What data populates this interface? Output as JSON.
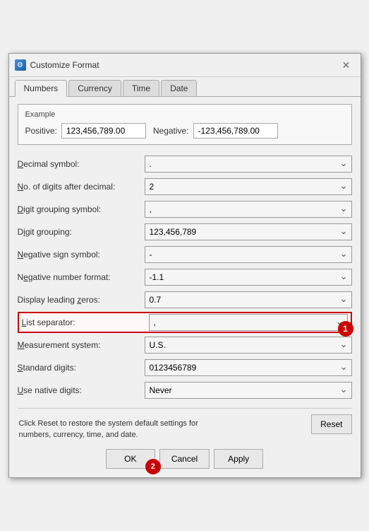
{
  "dialog": {
    "title": "Customize Format",
    "icon": "⚙"
  },
  "tabs": [
    {
      "label": "Numbers",
      "underline_index": 0,
      "active": true
    },
    {
      "label": "Currency",
      "underline_index": 0,
      "active": false
    },
    {
      "label": "Time",
      "underline_index": 0,
      "active": false
    },
    {
      "label": "Date",
      "underline_index": 0,
      "active": false
    }
  ],
  "example": {
    "label": "Example",
    "positive_label": "Positive:",
    "positive_value": "123,456,789.00",
    "negative_label": "Negative:",
    "negative_value": "-123,456,789.00"
  },
  "fields": [
    {
      "label": "Decimal symbol:",
      "underline": "D",
      "value": ".",
      "id": "decimal"
    },
    {
      "label": "No. of digits after decimal:",
      "underline": "N",
      "value": "2",
      "id": "digits"
    },
    {
      "label": "Digit grouping symbol:",
      "underline": "D",
      "value": ",",
      "id": "group_sym"
    },
    {
      "label": "Digit grouping:",
      "underline": "i",
      "value": "123,456,789",
      "id": "grouping"
    },
    {
      "label": "Negative sign symbol:",
      "underline": "N",
      "value": "-",
      "id": "neg_sign"
    },
    {
      "label": "Negative number format:",
      "underline": "e",
      "value": "-1.1",
      "id": "neg_format"
    },
    {
      "label": "Display leading zeros:",
      "underline": "z",
      "value": "0.7",
      "id": "lead_zeros"
    },
    {
      "label": "List separator:",
      "underline": "L",
      "value": ",",
      "id": "list_sep",
      "highlighted": true
    },
    {
      "label": "Measurement system:",
      "underline": "M",
      "value": "U.S.",
      "id": "measure"
    },
    {
      "label": "Standard digits:",
      "underline": "S",
      "value": "0123456789",
      "id": "std_digits"
    },
    {
      "label": "Use native digits:",
      "underline": "U",
      "value": "Never",
      "id": "native_digits"
    }
  ],
  "footer_text": "Click Reset to restore the system default settings for\nnumbers, currency, time, and date.",
  "buttons": {
    "reset": "Reset",
    "ok": "OK",
    "cancel": "Cancel",
    "apply": "Apply"
  },
  "badges": {
    "badge1": "1",
    "badge2": "2"
  }
}
